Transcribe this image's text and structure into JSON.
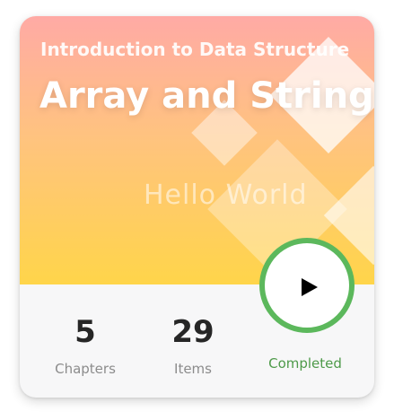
{
  "course": {
    "subtitle": "Introduction to Data Structure",
    "title": "Array and String",
    "watermark": "Hello World"
  },
  "stats": [
    {
      "value": "5",
      "label": "Chapters"
    },
    {
      "value": "29",
      "label": "Items"
    }
  ],
  "status": {
    "label": "Completed",
    "color": "#5cb85c"
  },
  "icons": {
    "play": "play-icon"
  },
  "colors": {
    "gradient_top": "#ffaaa5",
    "gradient_bottom": "#ffd54a",
    "accent_green": "#5cb85c"
  }
}
